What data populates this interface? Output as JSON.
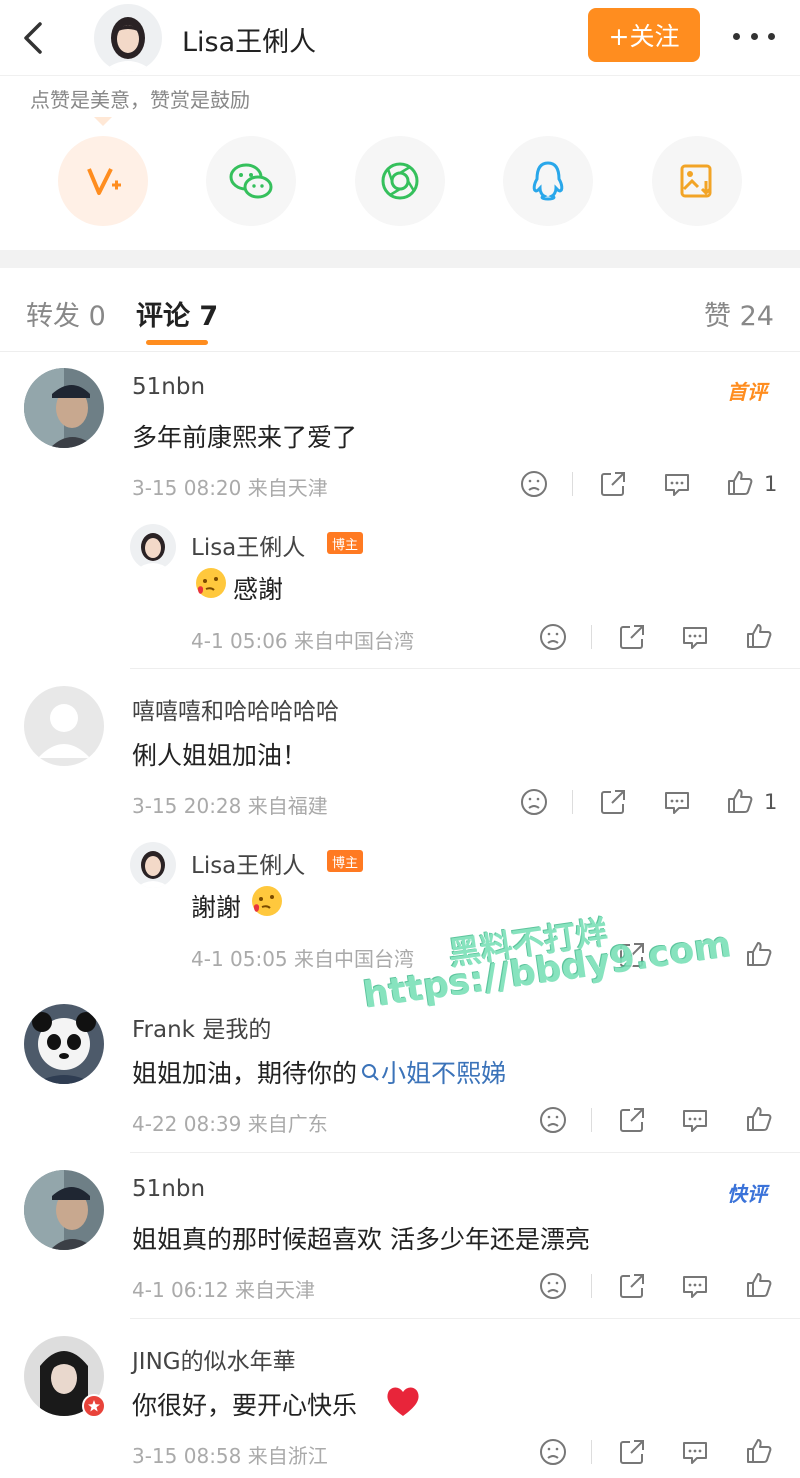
{
  "header": {
    "user_name": "Lisa王俐人",
    "follow_label": "+关注"
  },
  "share": {
    "hint": "点赞是美意，赞赏是鼓励",
    "items": [
      "v-plus-icon",
      "wechat-icon",
      "moments-icon",
      "qq-icon",
      "save-image-icon"
    ]
  },
  "tabs": {
    "repost": "转发 0",
    "comments": "评论 7",
    "likes": "赞 24"
  },
  "comments": [
    {
      "user": "51nbn",
      "text": "多年前康熙来了爱了",
      "meta": "3-15 08:20 来自天津",
      "tag": "首评",
      "likes": "1",
      "reply": {
        "user": "Lisa王俐人",
        "badge": "博主",
        "text": "感謝",
        "meta": "4-1 05:06 来自中国台湾"
      }
    },
    {
      "user": "嘻嘻嘻和哈哈哈哈哈",
      "text": "俐人姐姐加油！",
      "meta": "3-15 20:28 来自福建",
      "likes": "1",
      "reply": {
        "user": "Lisa王俐人",
        "badge": "博主",
        "text": "謝謝",
        "meta": "4-1 05:05 来自中国台湾"
      }
    },
    {
      "user": "Frank 是我的",
      "text": "姐姐加油，期待你的",
      "link": "小姐不熙娣",
      "meta": "4-22 08:39 来自广东"
    },
    {
      "user": "51nbn",
      "text": "姐姐真的那时候超喜欢  活多少年还是漂亮",
      "meta": "4-1 06:12 来自天津",
      "tag": "快评"
    },
    {
      "user": "JING的似水年華",
      "text": "你很好，要开心快乐",
      "meta": "3-15 08:58 来自浙江"
    }
  ],
  "watermark": {
    "line1": "黑料不打烊",
    "line2": "https://bbdy9.com"
  },
  "colors": {
    "accent": "#ff8d1f",
    "link": "#3b73b9",
    "host_badge": "#ff7a22"
  }
}
